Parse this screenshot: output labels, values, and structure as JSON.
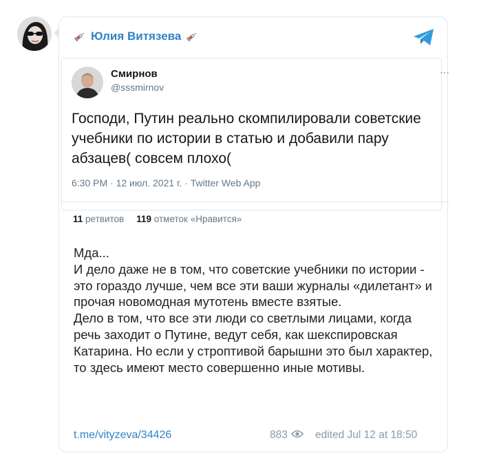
{
  "channel": {
    "name": "Юлия Витязева"
  },
  "tweet": {
    "author_name": "Смирнов",
    "author_handle": "@sssmirnov",
    "text": "Господи, Путин реально скомпилировали советские учебники по истории в статью и добавили пару абзацев( совсем плохо(",
    "meta": "6:30 PM · 12 июл. 2021 г. · Twitter Web App",
    "retweets_count": "11",
    "retweets_label": "ретвитов",
    "likes_count": "119",
    "likes_label": "отметок «Нравится»"
  },
  "message": {
    "text": "Мда...\nИ дело даже не в том, что советские учебники по истории - это гораздо лучше, чем все эти ваши журналы «дилетант» и прочая новомодная мутотень вместе взятые.\nДело в том, что все эти люди со светлыми лицами, когда речь заходит о Путине, ведут себя, как шекспировская Катарина. Но если у строптивой барышни это был характер, то здесь имеют место совершенно иные мотивы.",
    "link": "t.me/vityzeva/34426",
    "views": "883",
    "edited": "edited  Jul 12 at 18:50"
  },
  "colors": {
    "accent": "#2f82c4",
    "muted": "#8a9aa9",
    "border": "#e3e6ea"
  },
  "icons": [
    "syringe-icon",
    "telegram-icon",
    "eye-icon",
    "more-icon"
  ]
}
